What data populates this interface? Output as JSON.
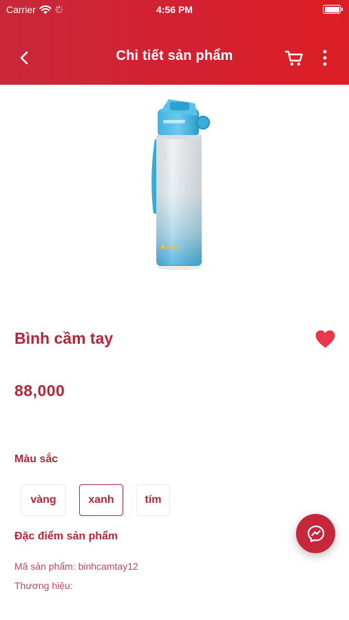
{
  "status_bar": {
    "carrier": "Carrier",
    "time": "4:56 PM"
  },
  "nav": {
    "title": "Chi tiết sản phẩm",
    "back_icon": "chevron-left-icon",
    "cart_icon": "cart-icon",
    "more_icon": "more-vertical-icon"
  },
  "product": {
    "name": "Bình cầm tay",
    "price": "88,000",
    "favorite": true,
    "image_brand_text": "Kim-Lon"
  },
  "colors": {
    "label": "Màu sắc",
    "options": [
      "vàng",
      "xanh",
      "tím"
    ],
    "selected": "xanh"
  },
  "features": {
    "label": "Đặc điểm sản phẩm",
    "sku_line": "Mã sản phẩm: binhcamtay12",
    "brand_line": "Thương hiệu:"
  },
  "fab": {
    "icon": "messenger-icon"
  },
  "theme": {
    "primary": "#d42030",
    "text_accent": "#b02739",
    "heart": "#e8394a"
  }
}
